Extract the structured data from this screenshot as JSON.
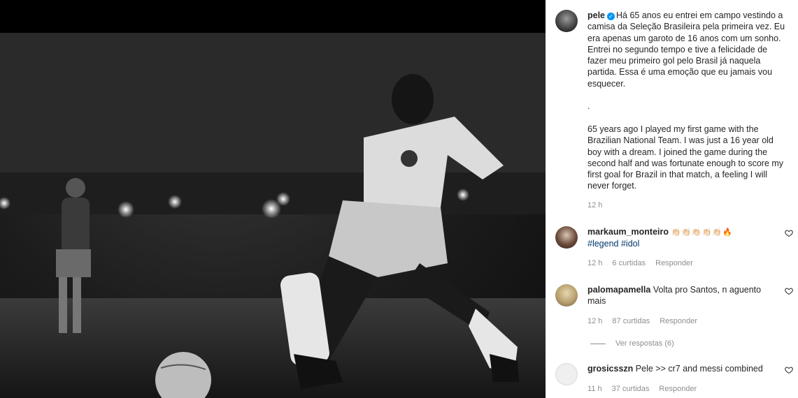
{
  "post": {
    "username": "pele",
    "caption_pt": "Há 65 anos eu entrei em campo vestindo a camisa da Seleção Brasileira pela primeira vez. Eu era apenas um garoto de 16 anos com um sonho. Entrei no segundo tempo e tive a felicidade de fazer meu primeiro gol pelo Brasil já naquela partida. Essa é uma emoção que eu jamais vou esquecer.",
    "separator": ".",
    "caption_en": "65 years ago I played my first game with the Brazilian National Team. I was just a 16 year old boy with a dream. I joined the game during the second half and was fortunate enough to score my first goal for Brazil in that match, a feeling I will never forget.",
    "time": "12 h"
  },
  "comments": [
    {
      "username": "markaum_monteiro",
      "text": "👏🏻👏🏻👏🏻👏🏻👏🏻🔥",
      "tags": "#legend #idol",
      "time": "12 h",
      "likes": "6 curtidas",
      "reply": "Responder"
    },
    {
      "username": "palomapamella",
      "text": "Volta pro Santos, n aguento mais",
      "time": "12 h",
      "likes": "87 curtidas",
      "reply": "Responder",
      "view_replies": "Ver respostas (6)"
    },
    {
      "username": "grosicsszn",
      "text": "Pele >> cr7 and messi combined",
      "time": "11 h",
      "likes": "37 curtidas",
      "reply": "Responder"
    }
  ],
  "icons": {
    "verified": "verified-badge-icon",
    "like": "heart-icon"
  },
  "colors": {
    "text": "#262626",
    "muted": "#8e8e8e",
    "link": "#00376b",
    "verified": "#0095f6"
  }
}
